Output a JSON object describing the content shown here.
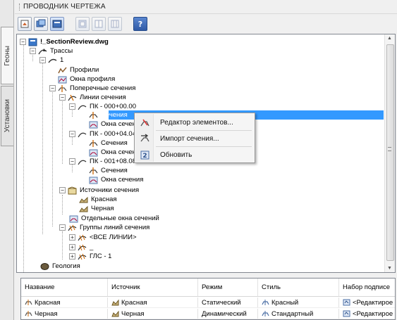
{
  "side_tabs": [
    "Геоны",
    "Установки"
  ],
  "window_title": "ПРОВОДНИК ЧЕРТЕЖА",
  "toolbar": [
    "pin-icon",
    "layers-icon",
    "layers-active-icon",
    "window-icon",
    "split-icon",
    "split2-icon",
    "help-icon"
  ],
  "tree": {
    "root": "!_SectionReview.dwg",
    "alignments": "Трассы",
    "alignment_1": "1",
    "profiles": "Профили",
    "profile_views": "Окна профиля",
    "cross_sections": "Поперечные сечения",
    "sample_lines": "Линии сечения",
    "pk1": "ПК - 000+00.00",
    "sections_1": "Сечения",
    "section_views_1": "Окна сечения",
    "pk2": "ПК - 000+04.04",
    "sections_2": "Сечения",
    "section_views_2": "Окна сечения",
    "pk3": "ПК - 001+08.08",
    "sections_3": "Сечения",
    "section_views_3": "Окна сечения",
    "section_sources": "Источники сечения",
    "src_red": "Красная",
    "src_black": "Черная",
    "single_views": "Отдельные окна сечений",
    "groups": "Группы линий сечения",
    "all_lines": "<ВСЕ ЛИНИИ>",
    "group_blank": "_",
    "group_gls": "ГЛС - 1",
    "geology": "Геология"
  },
  "context_menu": {
    "edit": "Редактор элементов...",
    "import": "Импорт сечения...",
    "refresh": "Обновить"
  },
  "grid": {
    "columns": [
      "Название",
      "Источник",
      "Режим",
      "Стиль",
      "Набор подписе"
    ],
    "rows": [
      [
        "Красная",
        "Красная",
        "Статический",
        "Красный",
        "<Редактирое"
      ],
      [
        "Черная",
        "Черная",
        "Динамический",
        "Стандартный",
        "<Редактирое"
      ]
    ]
  }
}
